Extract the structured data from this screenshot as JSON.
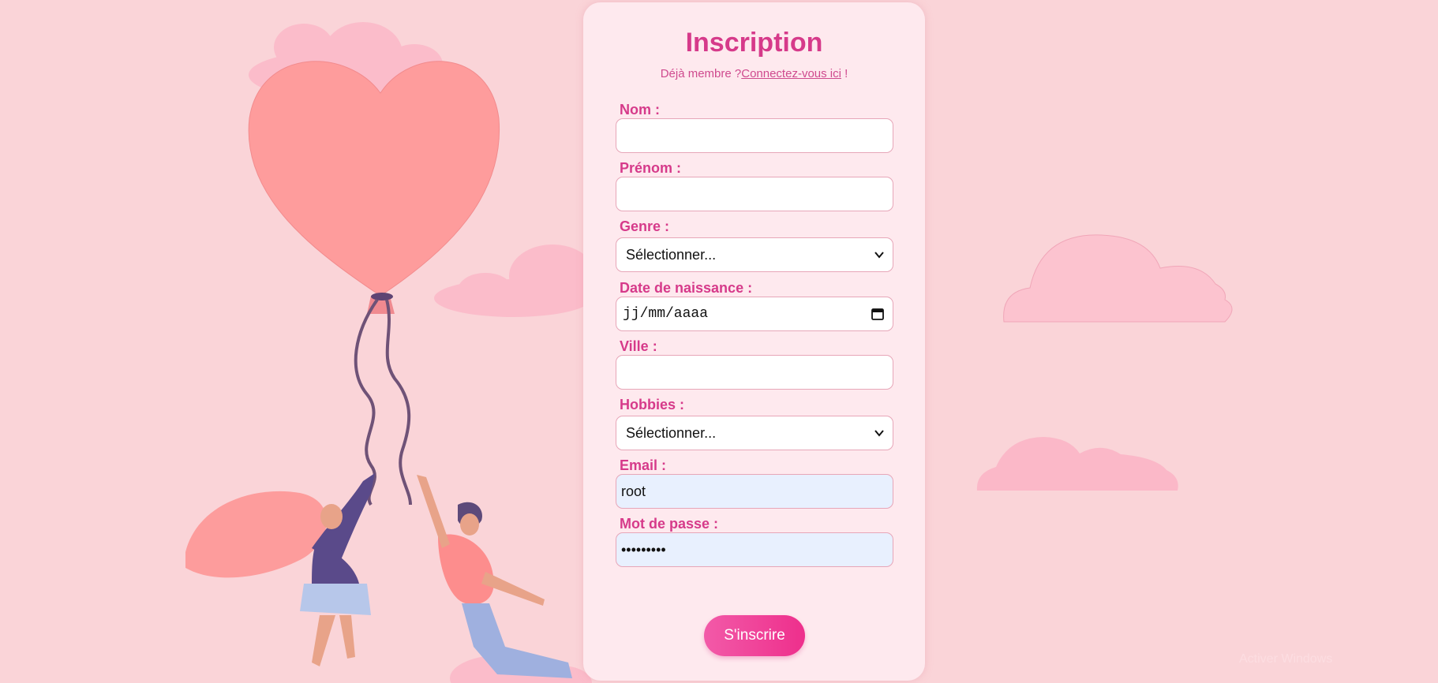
{
  "form": {
    "title": "Inscription",
    "subtitle_prefix": "Déjà membre ?",
    "login_link": "Connectez-vous ici",
    "subtitle_suffix": " !",
    "fields": {
      "nom": {
        "label": "Nom :",
        "value": ""
      },
      "prenom": {
        "label": "Prénom :",
        "value": ""
      },
      "genre": {
        "label": "Genre :",
        "selected": "Sélectionner..."
      },
      "date": {
        "label": "Date de naissance :",
        "placeholder": "jj/mm/aaaa"
      },
      "ville": {
        "label": "Ville :",
        "value": ""
      },
      "hobbies": {
        "label": "Hobbies :",
        "selected": "Sélectionner..."
      },
      "email": {
        "label": "Email :",
        "value": "root"
      },
      "password": {
        "label": "Mot de passe :",
        "value": "•••••••••"
      }
    },
    "submit_label": "S'inscrire"
  },
  "icons": {
    "select_arrow": "chevron-down-icon",
    "date_picker": "calendar-icon"
  },
  "colors": {
    "page_background": "#fad4d8",
    "card_background": "#fee9ee",
    "accent": "#d63a8a",
    "button_start": "#f25aa8",
    "button_end": "#ee2f8c",
    "autofill_background": "#e8f0fe"
  }
}
